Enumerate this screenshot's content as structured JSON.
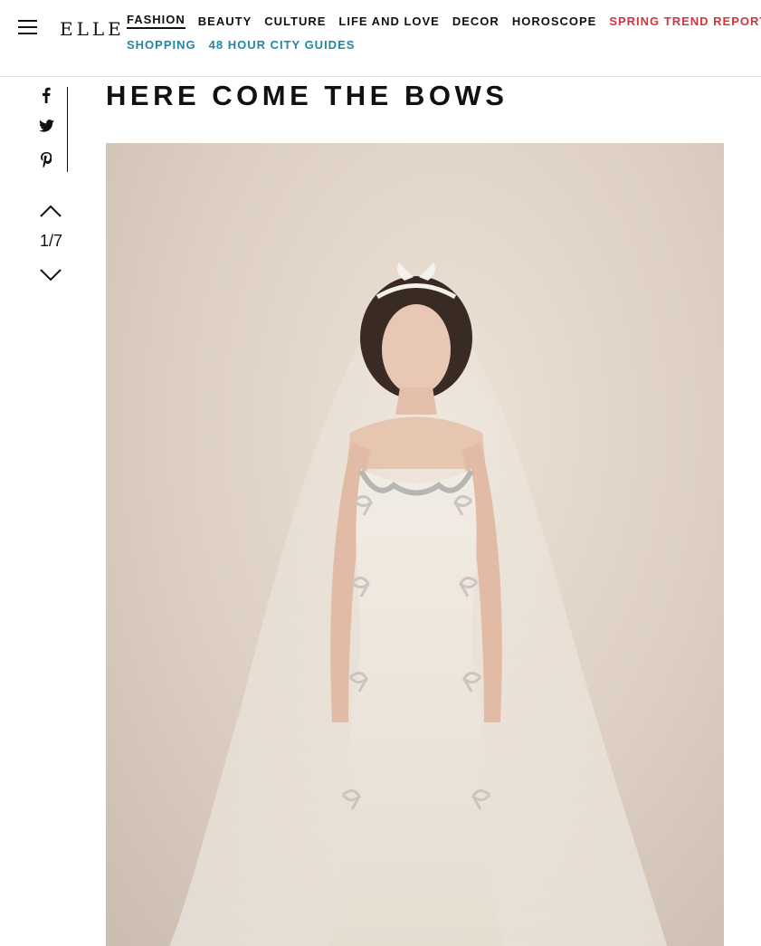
{
  "header": {
    "logo": "ELLE",
    "nav": [
      {
        "label": "FASHION"
      },
      {
        "label": "BEAUTY"
      },
      {
        "label": "CULTURE"
      },
      {
        "label": "LIFE AND LOVE"
      },
      {
        "label": "DECOR"
      },
      {
        "label": "HOROSCOPE"
      },
      {
        "label": "SPRING TREND REPORT"
      },
      {
        "label": "SHOPPING"
      },
      {
        "label": "48 HOUR CITY GUIDES"
      }
    ]
  },
  "share": {
    "icons": [
      "facebook-icon",
      "twitter-icon",
      "pinterest-icon"
    ]
  },
  "gallery": {
    "counter": "1/7",
    "title": "HERE COME THE BOWS"
  },
  "colors": {
    "accent_red": "#d4343c",
    "accent_blue": "#2386a8",
    "text": "#111111"
  }
}
